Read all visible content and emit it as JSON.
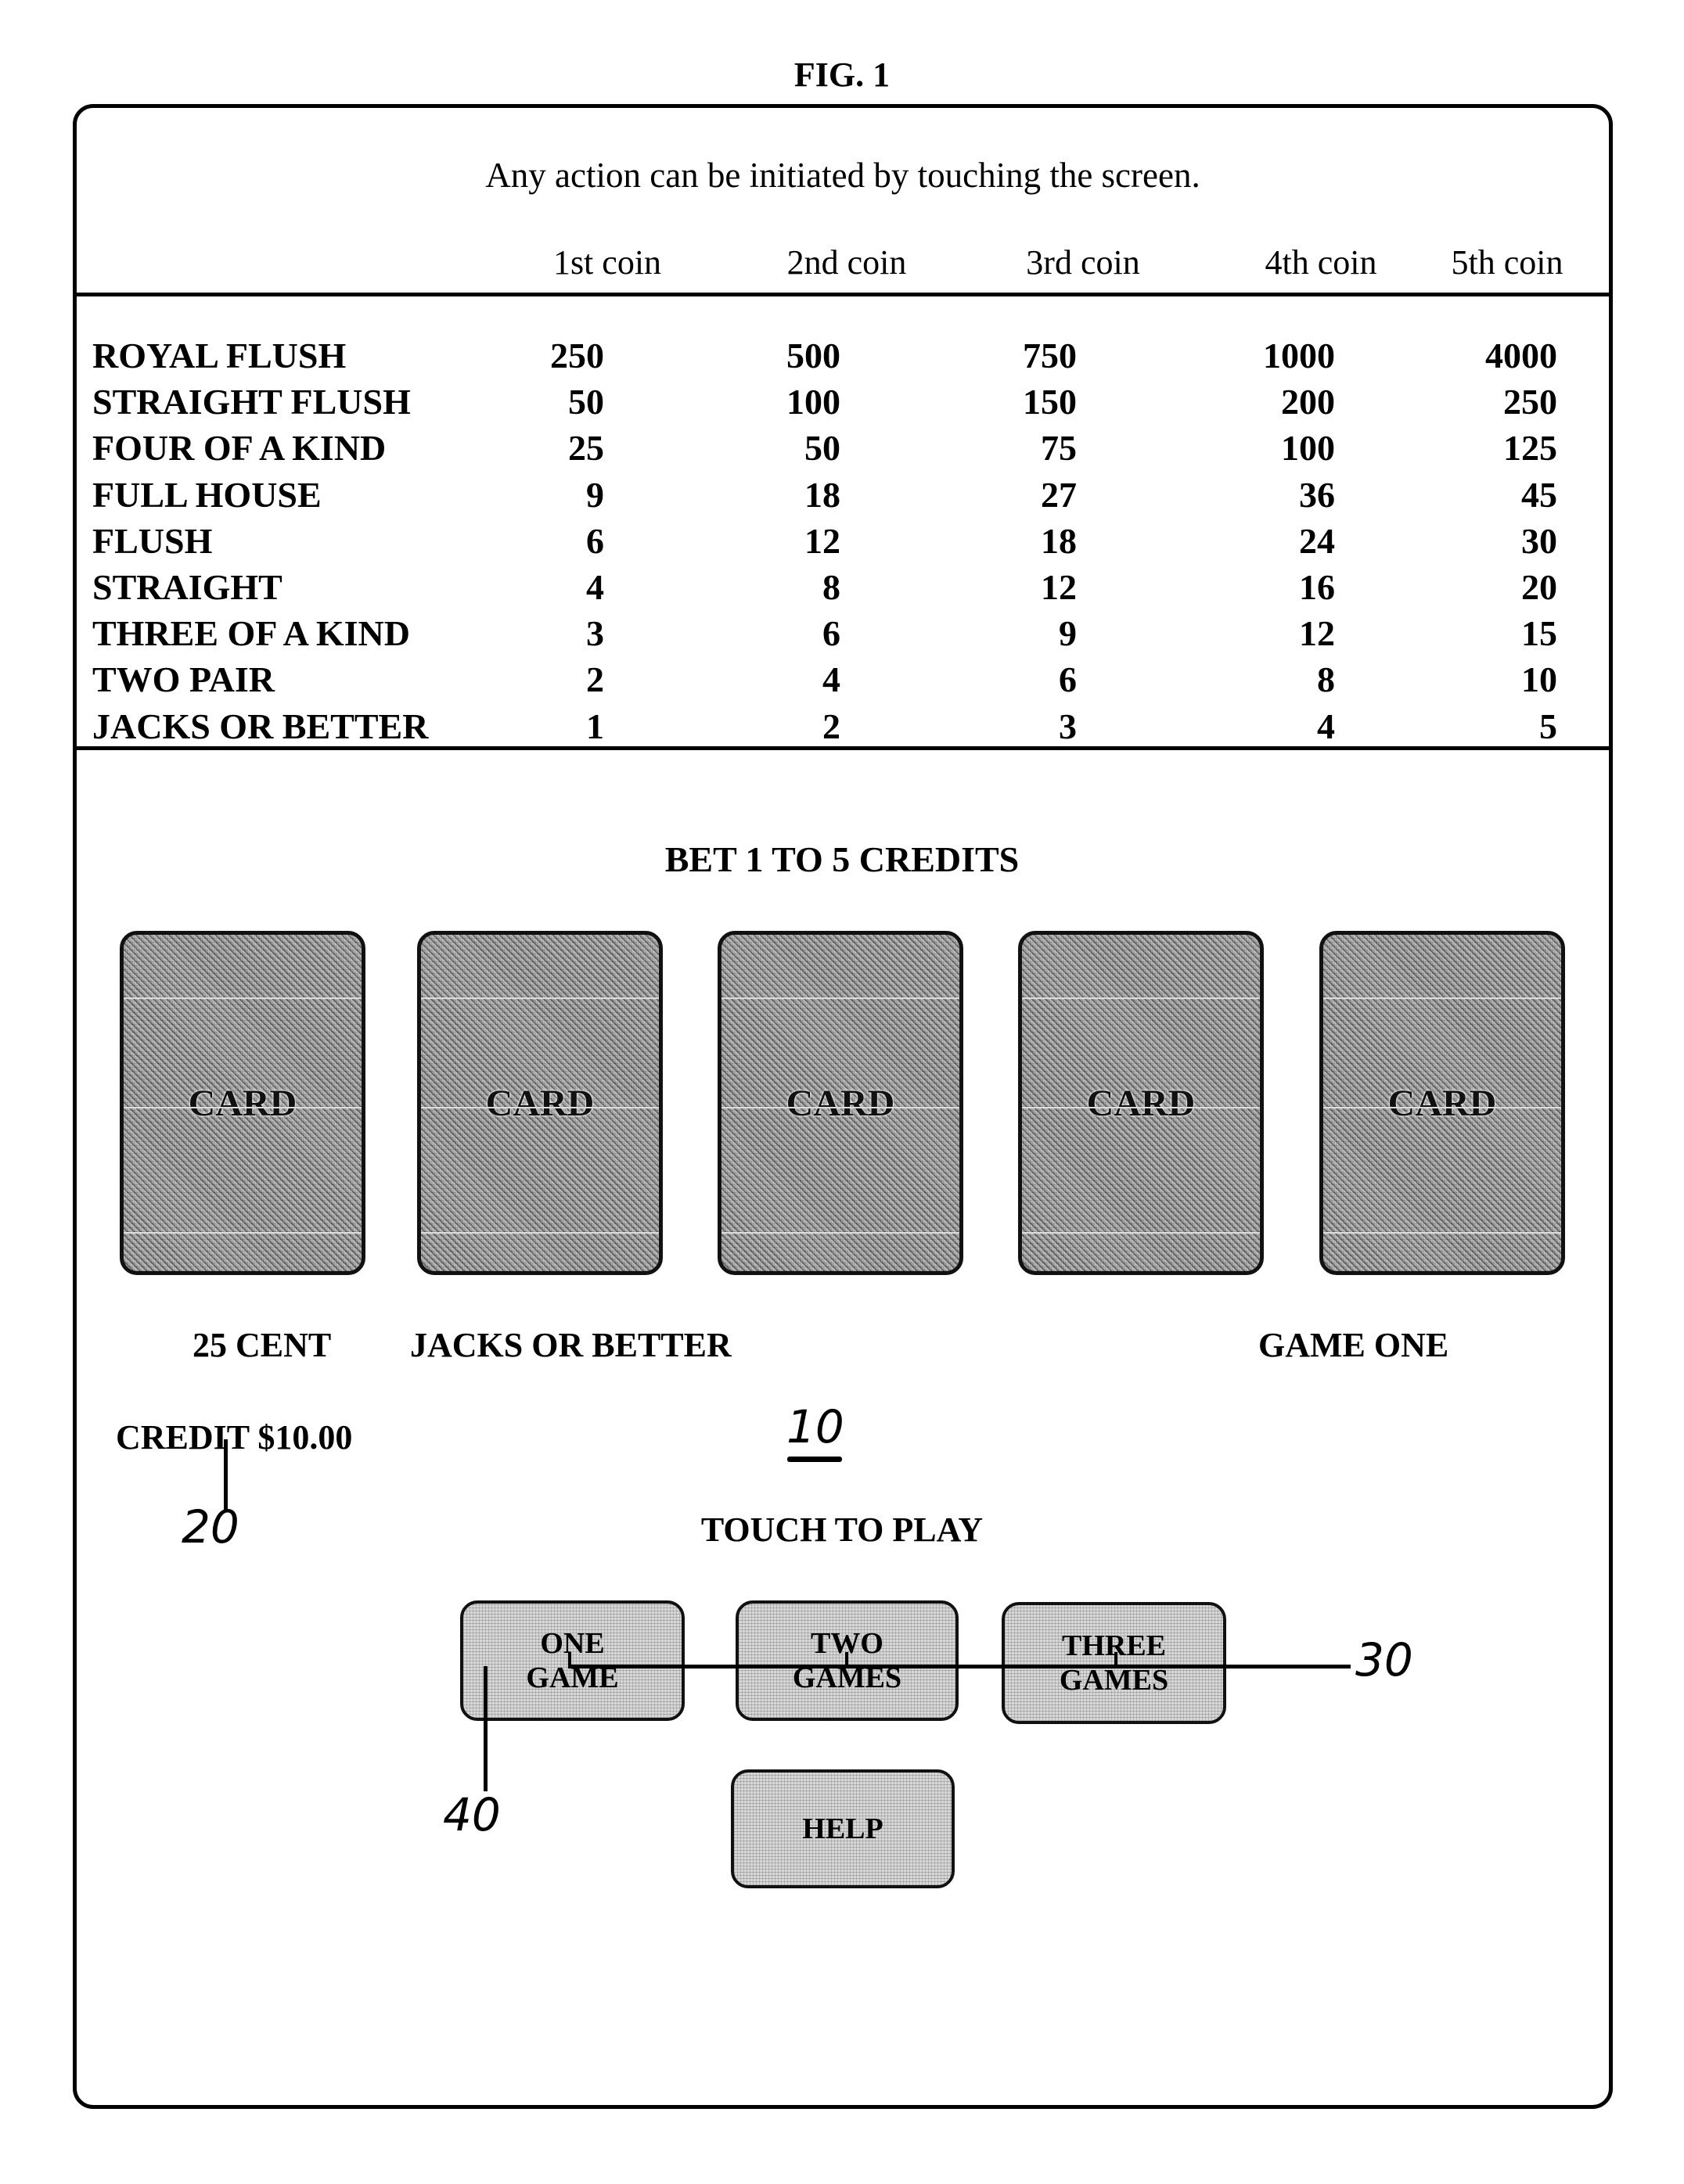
{
  "figure": {
    "title": "FIG. 1"
  },
  "screen": {
    "instruction": "Any action can be initiated by touching the screen.",
    "paytable": {
      "columns": [
        "1st coin",
        "2nd coin",
        "3rd coin",
        "4th coin",
        "5th coin"
      ],
      "rows": [
        {
          "hand": "ROYAL FLUSH",
          "payouts": [
            "250",
            "500",
            "750",
            "1000",
            "4000"
          ]
        },
        {
          "hand": "STRAIGHT FLUSH",
          "payouts": [
            "50",
            "100",
            "150",
            "200",
            "250"
          ]
        },
        {
          "hand": "FOUR OF A KIND",
          "payouts": [
            "25",
            "50",
            "75",
            "100",
            "125"
          ]
        },
        {
          "hand": "FULL HOUSE",
          "payouts": [
            "9",
            "18",
            "27",
            "36",
            "45"
          ]
        },
        {
          "hand": "FLUSH",
          "payouts": [
            "6",
            "12",
            "18",
            "24",
            "30"
          ]
        },
        {
          "hand": "STRAIGHT",
          "payouts": [
            "4",
            "8",
            "12",
            "16",
            "20"
          ]
        },
        {
          "hand": "THREE OF A KIND",
          "payouts": [
            "3",
            "6",
            "9",
            "12",
            "15"
          ]
        },
        {
          "hand": "TWO PAIR",
          "payouts": [
            "2",
            "4",
            "6",
            "8",
            "10"
          ]
        },
        {
          "hand": "JACKS OR BETTER",
          "payouts": [
            "1",
            "2",
            "3",
            "4",
            "5"
          ]
        }
      ]
    },
    "bet_prompt": "BET 1 TO 5 CREDITS",
    "cards": [
      "CARD",
      "CARD",
      "CARD",
      "CARD",
      "CARD"
    ],
    "denomination": "25 CENT",
    "game_type": "JACKS OR BETTER",
    "game_name": "GAME ONE",
    "credit": "CREDIT $10.00",
    "touch_prompt": "TOUCH TO PLAY",
    "buttons": {
      "one_game": [
        "ONE",
        "GAME"
      ],
      "two_games": [
        "TWO",
        "GAMES"
      ],
      "three_games": [
        "THREE",
        "GAMES"
      ],
      "help": "HELP"
    }
  },
  "reference_numerals": {
    "screen": "10",
    "credit": "20",
    "game_buttons": "30",
    "one_game_button": "40"
  }
}
